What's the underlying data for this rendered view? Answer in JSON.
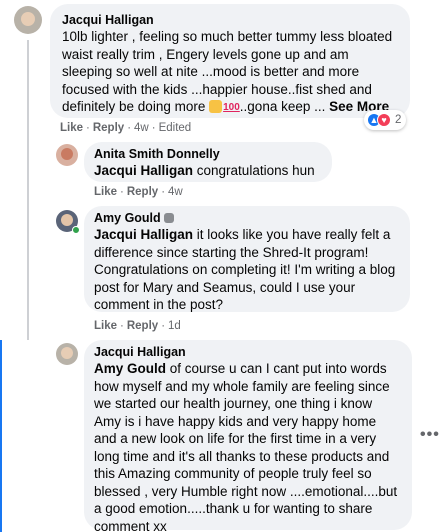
{
  "comments": [
    {
      "author": "Jacqui Halligan",
      "text": "10lb lighter , feeling so much better tummy less bloated waist really trim , Engery levels gone up and am sleeping so well at nite ...mood is better and more focused with the kids ...happier house..fist shed and definitely be doing more",
      "text_tail": "..gona keep ...",
      "see_more": "See More",
      "emoji_icons": [
        "ok-hand-emoji",
        "hundred-emoji"
      ],
      "like": "Like",
      "reply": "Reply",
      "time": "4w",
      "edited": "Edited",
      "reactions_count": "2",
      "reaction_colors": {
        "like": "#1877f2",
        "love": "#f33e58"
      }
    },
    {
      "author": "Anita Smith Donnelly",
      "mention": "Jacqui Halligan",
      "text": " congratulations hun",
      "like": "Like",
      "reply": "Reply",
      "time": "4w"
    },
    {
      "author": "Amy Gould",
      "author_icon": "waving-hand-emoji",
      "mention": "Jacqui Halligan",
      "text": " it looks like you have really felt a difference since starting the Shred-It program! Congratulations on completing it! I'm writing a blog post for Mary and Seamus, could I use your comment in the post?",
      "like": "Like",
      "reply": "Reply",
      "time": "1d"
    },
    {
      "author": "Jacqui Halligan",
      "mention": "Amy Gould",
      "text": " of course u can I cant put into words how myself and my whole family are feeling since we started our health journey, one thing i know Amy is i have happy kids and very happy home and a new look on life for the first time in a very long time and it's all thanks to these products and this Amazing community of people truly feel so blessed , very Humble right now ....emotional....but a good emotion.....thank u for wanting to share comment xx",
      "more_icon": "ellipsis-icon",
      "more_label": "•••"
    }
  ]
}
